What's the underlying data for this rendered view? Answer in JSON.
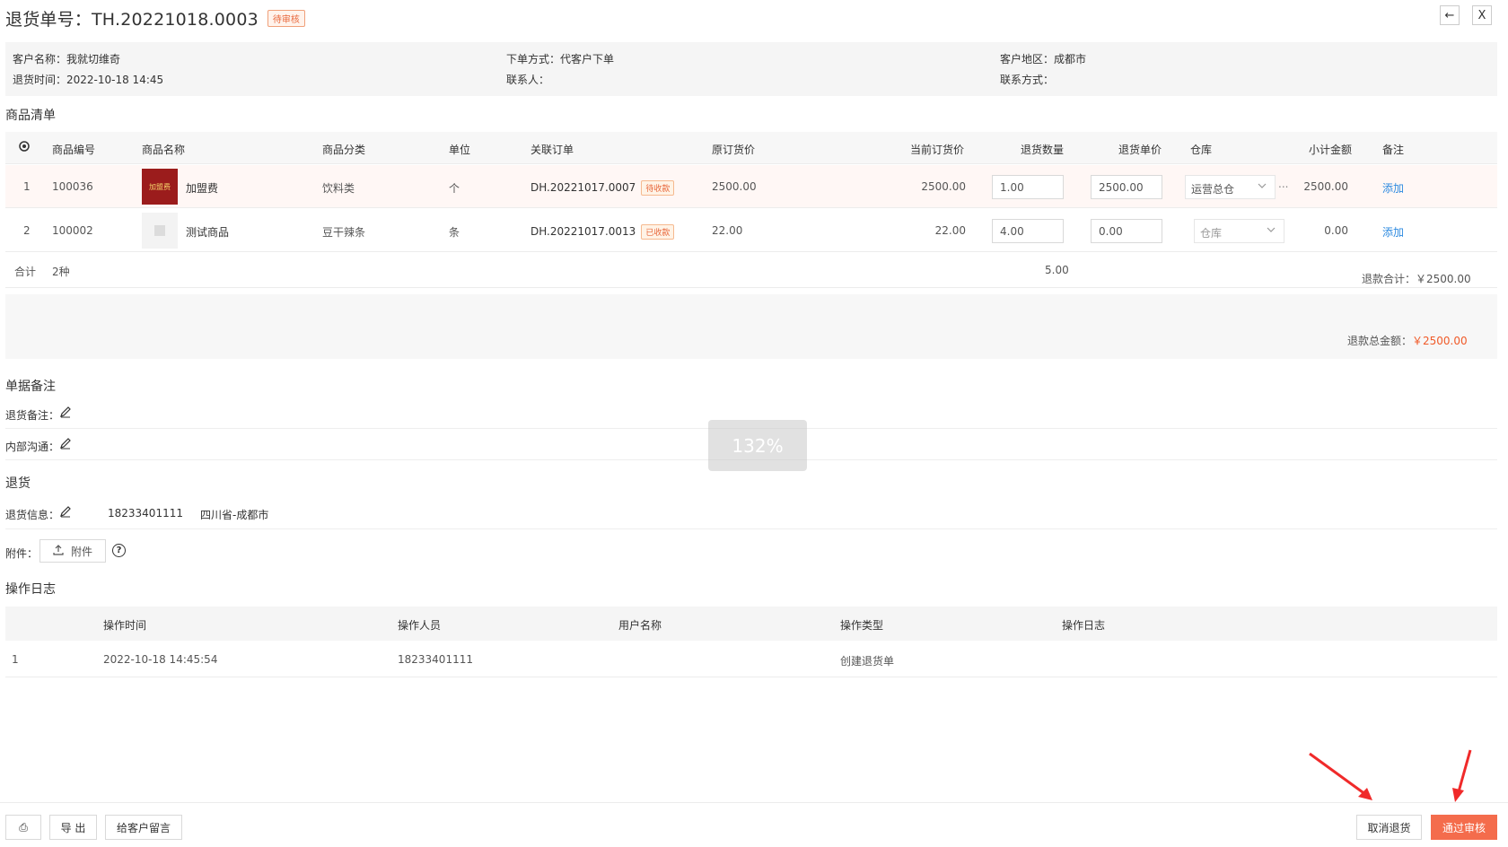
{
  "header": {
    "title": "退货单号：TH.20221018.0003",
    "status": "待审核",
    "back_icon": "back-arrow-icon",
    "close_icon": "close-icon",
    "back_glyph": "←",
    "close_glyph": "X"
  },
  "info": {
    "customer_name": "客户名称：我就切维奇",
    "return_time": "退货时间：2022-10-18 14:45",
    "order_method": "下单方式：代客户下单",
    "contact_person": "联系人：",
    "region": "客户地区：成都市",
    "contact_info": "联系方式："
  },
  "goods": {
    "section_title": "商品清单",
    "columns": [
      "商品编号",
      "商品名称",
      "商品分类",
      "单位",
      "关联订单",
      "原订货价",
      "当前订货价",
      "退货数量",
      "退货单价",
      "仓库",
      "小计金额",
      "备注"
    ],
    "rows": [
      {
        "index": "1",
        "code": "100036",
        "thumb_text": "加盟费",
        "name": "加盟费",
        "category": "饮料类",
        "unit": "个",
        "order": "DH.20221017.0007",
        "order_tag": "待收款",
        "orig_price": "2500.00",
        "cur_price": "2500.00",
        "qty": "1.00",
        "unit_price": "2500.00",
        "warehouse": "运营总仓",
        "subtotal": "2500.00",
        "remark": "添加"
      },
      {
        "index": "2",
        "code": "100002",
        "thumb_text": "",
        "name": "测试商品",
        "category": "豆干辣条",
        "unit": "条",
        "order": "DH.20221017.0013",
        "order_tag": "已收款",
        "orig_price": "22.00",
        "cur_price": "22.00",
        "qty": "4.00",
        "unit_price": "0.00",
        "warehouse": "仓库",
        "subtotal": "0.00",
        "remark": "添加"
      }
    ],
    "sum_label": "合计",
    "sum_kinds": "2种",
    "sum_qty": "5.00",
    "refund_total": "退款合计：￥2500.00",
    "refund_grand_label": "退款总金额：",
    "refund_grand_value": "￥2500.00",
    "more_glyph": "..."
  },
  "remarks": {
    "section_title": "单据备注",
    "return_remark": "退货备注：",
    "internal": "内部沟通："
  },
  "return": {
    "section_title": "退货",
    "info_label": "退货信息：",
    "phone": "18233401111",
    "address": "四川省-成都市",
    "attach_label": "附件：",
    "attach_button": "附件",
    "help": "?"
  },
  "log": {
    "section_title": "操作日志",
    "columns": [
      "操作时间",
      "操作人员",
      "用户名称",
      "操作类型",
      "操作日志"
    ],
    "rows": [
      {
        "index": "1",
        "time": "2022-10-18 14:45:54",
        "operator": "18233401111",
        "username": "",
        "type": "创建退货单",
        "log": ""
      }
    ]
  },
  "zoom": "132%",
  "footer": {
    "print_glyph": "⎙",
    "export": "导 出",
    "message": "给客户留言",
    "cancel": "取消退货",
    "approve": "通过审核"
  },
  "colors": {
    "accent": "#f46c4c",
    "link": "#2f8be0",
    "warning": "#e8683c"
  }
}
